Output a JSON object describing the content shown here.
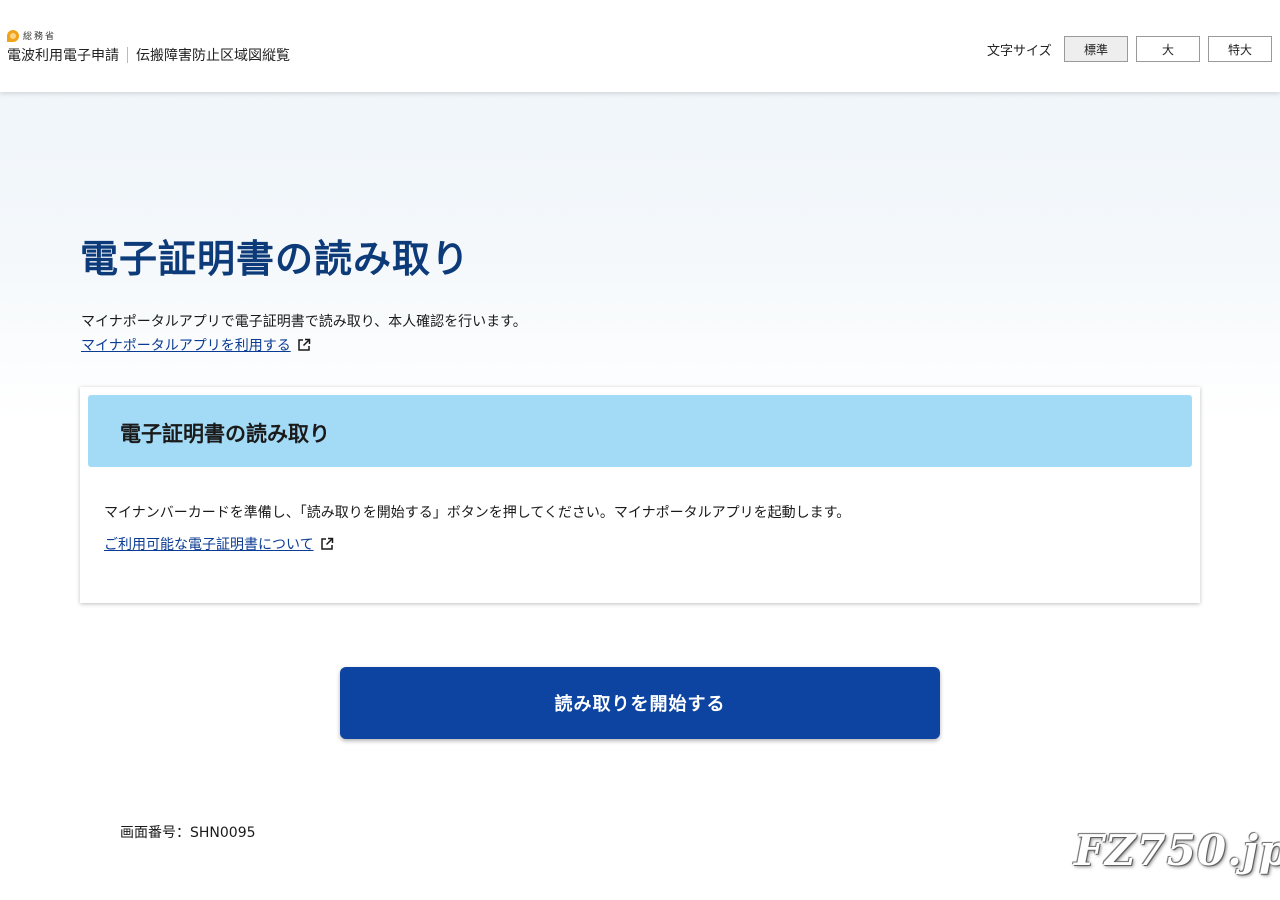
{
  "header": {
    "ministry": "総務省",
    "app_name": "電波利用電子申請",
    "section_name": "伝搬障害防止区域図縦覧",
    "font_size_label": "文字サイズ",
    "font_size_options": [
      "標準",
      "大",
      "特大"
    ],
    "font_size_selected": "標準"
  },
  "main": {
    "title": "電子証明書の読み取り",
    "lead": "マイナポータルアプリで電子証明書で読み取り、本人確認を行います。",
    "lead_link": "マイナポータルアプリを利用する"
  },
  "card": {
    "title": "電子証明書の読み取り",
    "text": "マイナンバーカードを準備し、「読み取りを開始する」ボタンを押してください。マイナポータルアプリを起動します。",
    "link": "ご利用可能な電子証明書について"
  },
  "actions": {
    "start_label": "読み取りを開始する"
  },
  "footer": {
    "screen_number": "画面番号：SHN0095"
  },
  "watermark": "FZ750.jp",
  "colors": {
    "title": "#0d3b7a",
    "card_header": "#a3daf5",
    "primary_button": "#0d43a1",
    "link": "#0b3c93"
  },
  "icons": [
    "ministry-logo-icon",
    "external-link-icon"
  ]
}
